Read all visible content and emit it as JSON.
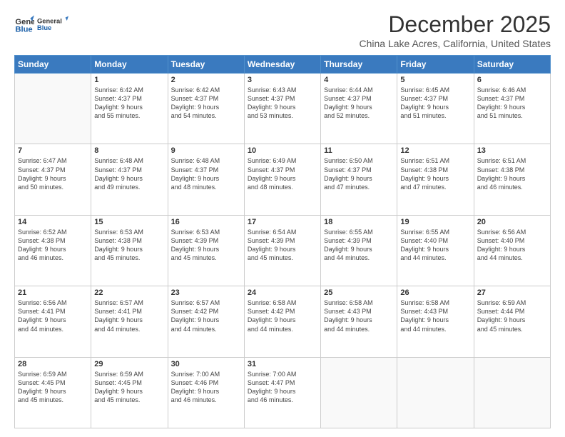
{
  "logo": {
    "line1": "General",
    "line2": "Blue"
  },
  "title": "December 2025",
  "location": "China Lake Acres, California, United States",
  "weekdays": [
    "Sunday",
    "Monday",
    "Tuesday",
    "Wednesday",
    "Thursday",
    "Friday",
    "Saturday"
  ],
  "weeks": [
    [
      {
        "day": "",
        "info": ""
      },
      {
        "day": "1",
        "info": "Sunrise: 6:42 AM\nSunset: 4:37 PM\nDaylight: 9 hours\nand 55 minutes."
      },
      {
        "day": "2",
        "info": "Sunrise: 6:42 AM\nSunset: 4:37 PM\nDaylight: 9 hours\nand 54 minutes."
      },
      {
        "day": "3",
        "info": "Sunrise: 6:43 AM\nSunset: 4:37 PM\nDaylight: 9 hours\nand 53 minutes."
      },
      {
        "day": "4",
        "info": "Sunrise: 6:44 AM\nSunset: 4:37 PM\nDaylight: 9 hours\nand 52 minutes."
      },
      {
        "day": "5",
        "info": "Sunrise: 6:45 AM\nSunset: 4:37 PM\nDaylight: 9 hours\nand 51 minutes."
      },
      {
        "day": "6",
        "info": "Sunrise: 6:46 AM\nSunset: 4:37 PM\nDaylight: 9 hours\nand 51 minutes."
      }
    ],
    [
      {
        "day": "7",
        "info": "Sunrise: 6:47 AM\nSunset: 4:37 PM\nDaylight: 9 hours\nand 50 minutes."
      },
      {
        "day": "8",
        "info": "Sunrise: 6:48 AM\nSunset: 4:37 PM\nDaylight: 9 hours\nand 49 minutes."
      },
      {
        "day": "9",
        "info": "Sunrise: 6:48 AM\nSunset: 4:37 PM\nDaylight: 9 hours\nand 48 minutes."
      },
      {
        "day": "10",
        "info": "Sunrise: 6:49 AM\nSunset: 4:37 PM\nDaylight: 9 hours\nand 48 minutes."
      },
      {
        "day": "11",
        "info": "Sunrise: 6:50 AM\nSunset: 4:37 PM\nDaylight: 9 hours\nand 47 minutes."
      },
      {
        "day": "12",
        "info": "Sunrise: 6:51 AM\nSunset: 4:38 PM\nDaylight: 9 hours\nand 47 minutes."
      },
      {
        "day": "13",
        "info": "Sunrise: 6:51 AM\nSunset: 4:38 PM\nDaylight: 9 hours\nand 46 minutes."
      }
    ],
    [
      {
        "day": "14",
        "info": "Sunrise: 6:52 AM\nSunset: 4:38 PM\nDaylight: 9 hours\nand 46 minutes."
      },
      {
        "day": "15",
        "info": "Sunrise: 6:53 AM\nSunset: 4:38 PM\nDaylight: 9 hours\nand 45 minutes."
      },
      {
        "day": "16",
        "info": "Sunrise: 6:53 AM\nSunset: 4:39 PM\nDaylight: 9 hours\nand 45 minutes."
      },
      {
        "day": "17",
        "info": "Sunrise: 6:54 AM\nSunset: 4:39 PM\nDaylight: 9 hours\nand 45 minutes."
      },
      {
        "day": "18",
        "info": "Sunrise: 6:55 AM\nSunset: 4:39 PM\nDaylight: 9 hours\nand 44 minutes."
      },
      {
        "day": "19",
        "info": "Sunrise: 6:55 AM\nSunset: 4:40 PM\nDaylight: 9 hours\nand 44 minutes."
      },
      {
        "day": "20",
        "info": "Sunrise: 6:56 AM\nSunset: 4:40 PM\nDaylight: 9 hours\nand 44 minutes."
      }
    ],
    [
      {
        "day": "21",
        "info": "Sunrise: 6:56 AM\nSunset: 4:41 PM\nDaylight: 9 hours\nand 44 minutes."
      },
      {
        "day": "22",
        "info": "Sunrise: 6:57 AM\nSunset: 4:41 PM\nDaylight: 9 hours\nand 44 minutes."
      },
      {
        "day": "23",
        "info": "Sunrise: 6:57 AM\nSunset: 4:42 PM\nDaylight: 9 hours\nand 44 minutes."
      },
      {
        "day": "24",
        "info": "Sunrise: 6:58 AM\nSunset: 4:42 PM\nDaylight: 9 hours\nand 44 minutes."
      },
      {
        "day": "25",
        "info": "Sunrise: 6:58 AM\nSunset: 4:43 PM\nDaylight: 9 hours\nand 44 minutes."
      },
      {
        "day": "26",
        "info": "Sunrise: 6:58 AM\nSunset: 4:43 PM\nDaylight: 9 hours\nand 44 minutes."
      },
      {
        "day": "27",
        "info": "Sunrise: 6:59 AM\nSunset: 4:44 PM\nDaylight: 9 hours\nand 45 minutes."
      }
    ],
    [
      {
        "day": "28",
        "info": "Sunrise: 6:59 AM\nSunset: 4:45 PM\nDaylight: 9 hours\nand 45 minutes."
      },
      {
        "day": "29",
        "info": "Sunrise: 6:59 AM\nSunset: 4:45 PM\nDaylight: 9 hours\nand 45 minutes."
      },
      {
        "day": "30",
        "info": "Sunrise: 7:00 AM\nSunset: 4:46 PM\nDaylight: 9 hours\nand 46 minutes."
      },
      {
        "day": "31",
        "info": "Sunrise: 7:00 AM\nSunset: 4:47 PM\nDaylight: 9 hours\nand 46 minutes."
      },
      {
        "day": "",
        "info": ""
      },
      {
        "day": "",
        "info": ""
      },
      {
        "day": "",
        "info": ""
      }
    ]
  ]
}
